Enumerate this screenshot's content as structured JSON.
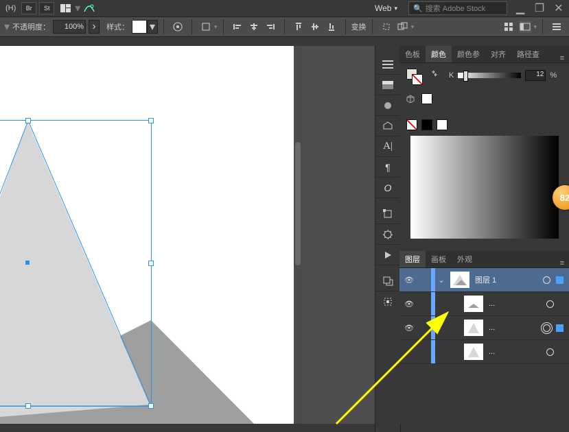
{
  "topbar1": {
    "menu_h": "(H)",
    "br": "Br",
    "st": "St",
    "workspace": "Web",
    "search_placeholder": "搜索 Adobe Stock"
  },
  "topbar2": {
    "opacity_label": "不透明度：",
    "opacity_value": "100%",
    "style_label": "样式：",
    "transform_label": "变换"
  },
  "colorpanel": {
    "tabs": [
      "色板",
      "颜色",
      "颜色参",
      "对齐",
      "路径查"
    ],
    "active_tab": 1,
    "k_label": "K",
    "k_value": "12",
    "percent": "%"
  },
  "layerspanel": {
    "tabs": [
      "图层",
      "画板",
      "外观"
    ],
    "active_tab": 0,
    "rows": [
      {
        "name": "图层 1",
        "dots": "",
        "selected": true,
        "disclose": true,
        "target": "square",
        "eye": true,
        "thumb": "tri-shaded"
      },
      {
        "name": "",
        "dots": "...",
        "selected": false,
        "disclose": false,
        "target": "circle",
        "eye": true,
        "thumb": "tri-flat"
      },
      {
        "name": "",
        "dots": "...",
        "selected": false,
        "disclose": false,
        "target": "circle-dbl",
        "eye": true,
        "thumb": "tri-shaded"
      },
      {
        "name": "",
        "dots": "...",
        "selected": false,
        "disclose": false,
        "target": "circle",
        "eye": false,
        "thumb": "tri-shaded"
      }
    ]
  },
  "badge": {
    "value": "82"
  }
}
